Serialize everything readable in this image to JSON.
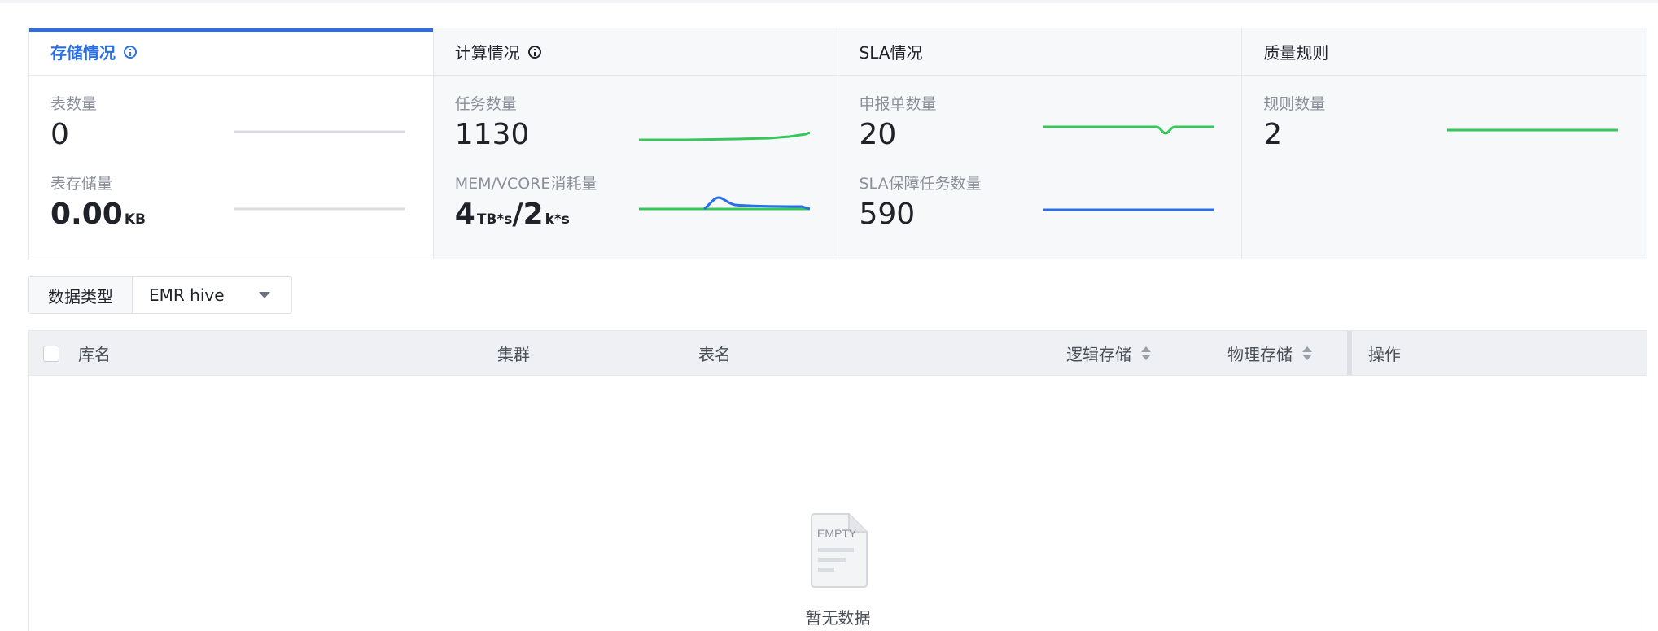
{
  "stats": {
    "storage": {
      "title": "存储情况",
      "m1_label": "表数量",
      "m1_value": "0",
      "m2_label": "表存储量",
      "m2_value": "0.00",
      "m2_unit": "KB"
    },
    "compute": {
      "title": "计算情况",
      "m1_label": "任务数量",
      "m1_value": "1130",
      "m2_label": "MEM/VCORE消耗量",
      "m2_v1": "4",
      "m2_u1": "TB*s",
      "m2_sep": "/",
      "m2_v2": "2",
      "m2_u2": "k*s"
    },
    "sla": {
      "title": "SLA情况",
      "m1_label": "申报单数量",
      "m1_value": "20",
      "m2_label": "SLA保障任务数量",
      "m2_value": "590"
    },
    "quality": {
      "title": "质量规则",
      "m1_label": "规则数量",
      "m1_value": "2"
    }
  },
  "filter": {
    "label": "数据类型",
    "value": "EMR hive"
  },
  "table": {
    "columns": [
      "库名",
      "集群",
      "表名",
      "逻辑存储",
      "物理存储",
      "操作"
    ],
    "empty_text": "暂无数据",
    "empty_art_text": "EMPTY"
  },
  "colors": {
    "accent": "#2a6ee8",
    "spark_green": "#34c759",
    "spark_blue": "#2a6ee8",
    "spark_gray": "#d9dce1"
  }
}
